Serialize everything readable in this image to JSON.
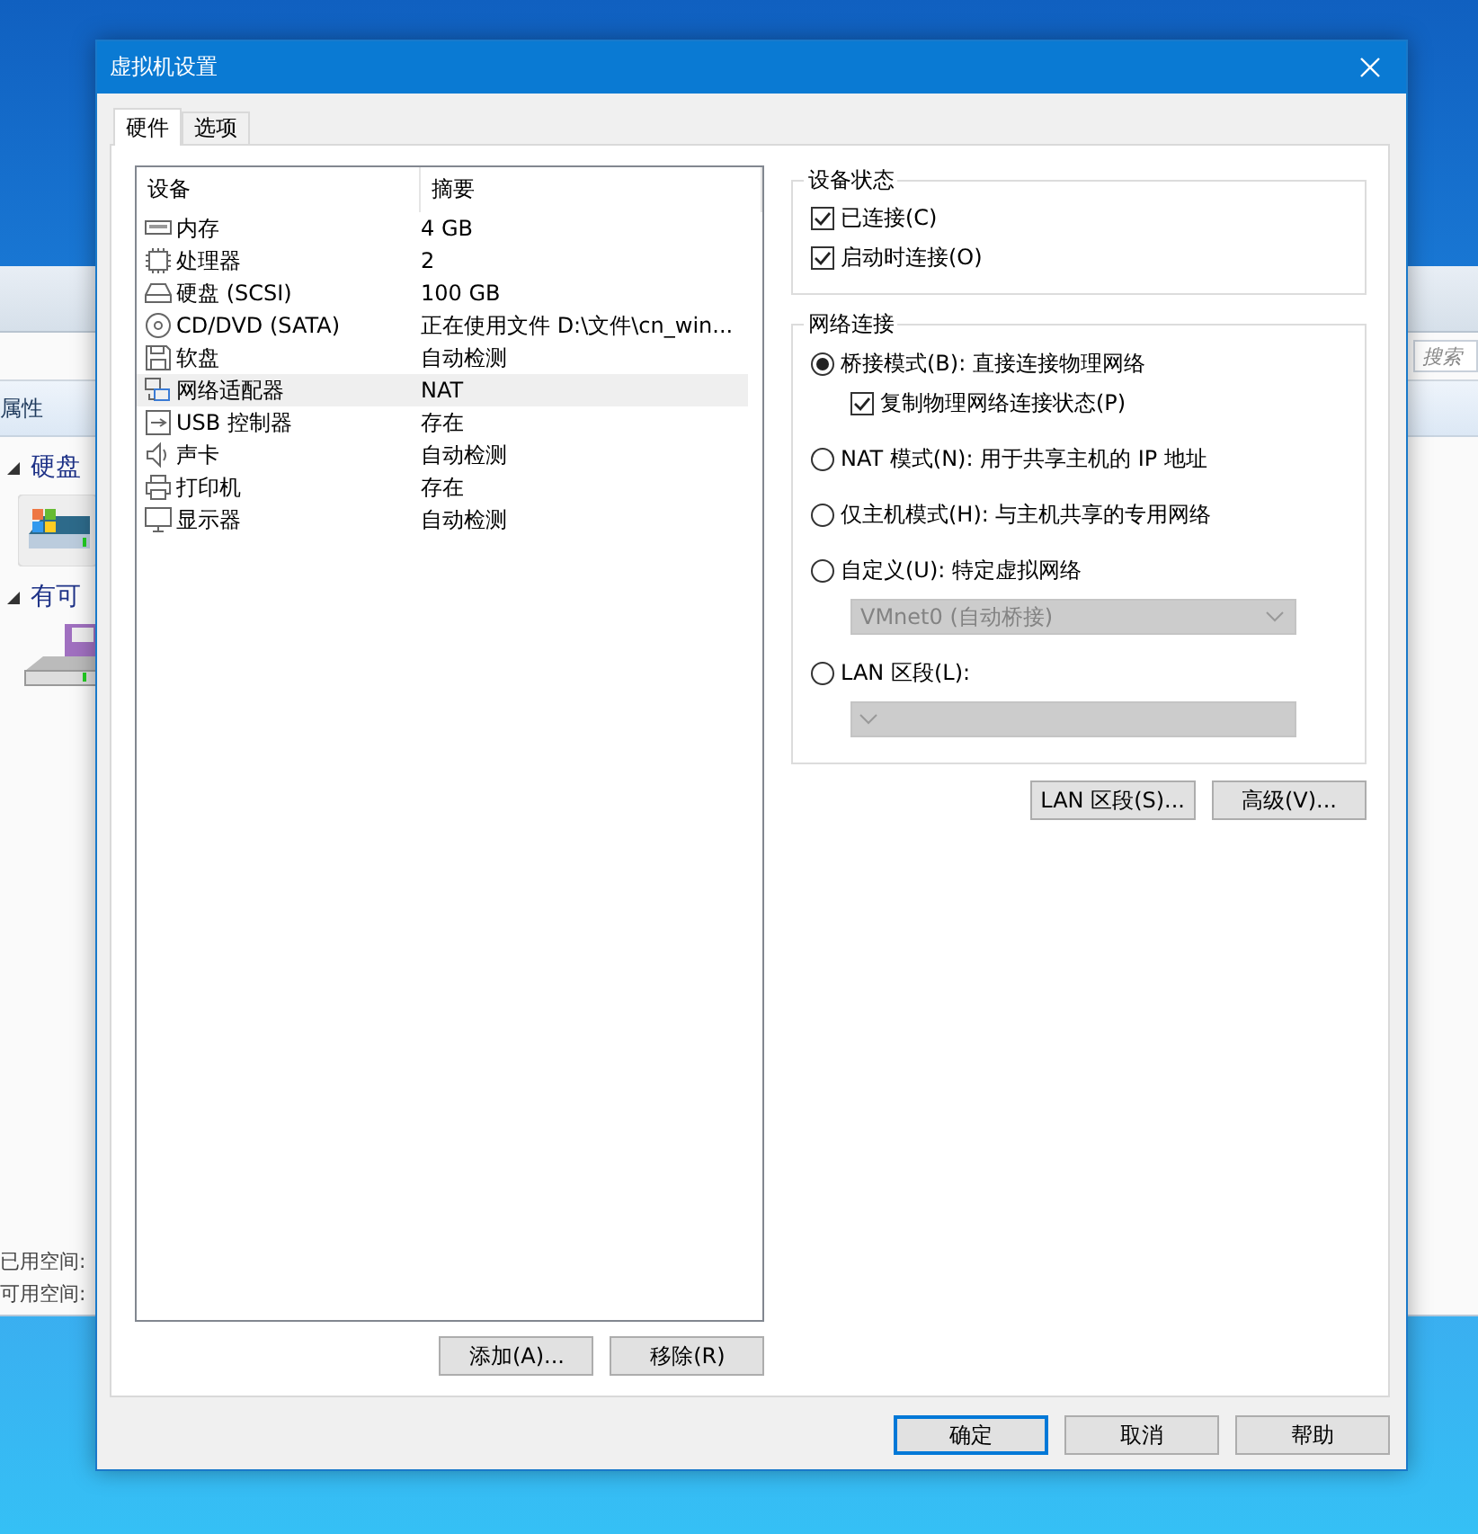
{
  "background_window": {
    "toolbar_label": "属性",
    "groups": [
      {
        "label": "硬盘",
        "kind": "hard-disk"
      },
      {
        "label": "有可",
        "kind": "removable"
      }
    ],
    "space_labels": [
      "已用空间:",
      "可用空间:"
    ],
    "search": {
      "placeholder": "搜索"
    }
  },
  "dialog": {
    "title": "虚拟机设置",
    "tabs": [
      {
        "label": "硬件",
        "selected": true
      },
      {
        "label": "选项",
        "selected": false
      }
    ],
    "device_table": {
      "columns": [
        "设备",
        "摘要"
      ],
      "rows": [
        {
          "kind": "memory",
          "device": "内存",
          "summary": "4 GB",
          "selected": false
        },
        {
          "kind": "cpu",
          "device": "处理器",
          "summary": "2",
          "selected": false
        },
        {
          "kind": "disk",
          "device": "硬盘 (SCSI)",
          "summary": "100 GB",
          "selected": false
        },
        {
          "kind": "cdrom",
          "device": "CD/DVD (SATA)",
          "summary": "正在使用文件 D:\\文件\\cn_win...",
          "selected": false
        },
        {
          "kind": "floppy",
          "device": "软盘",
          "summary": "自动检测",
          "selected": false
        },
        {
          "kind": "network",
          "device": "网络适配器",
          "summary": "NAT",
          "selected": true
        },
        {
          "kind": "usb",
          "device": "USB 控制器",
          "summary": "存在",
          "selected": false
        },
        {
          "kind": "sound",
          "device": "声卡",
          "summary": "自动检测",
          "selected": false
        },
        {
          "kind": "printer",
          "device": "打印机",
          "summary": "存在",
          "selected": false
        },
        {
          "kind": "display",
          "device": "显示器",
          "summary": "自动检测",
          "selected": false
        }
      ]
    },
    "device_buttons": [
      "添加(A)...",
      "移除(R)"
    ],
    "device_status": {
      "title": "设备状态",
      "options": [
        {
          "label": "已连接(C)",
          "checked": true
        },
        {
          "label": "启动时连接(O)",
          "checked": true
        }
      ]
    },
    "network": {
      "title": "网络连接",
      "options": [
        {
          "kind": "radio",
          "label": "桥接模式(B): 直接连接物理网络",
          "selected": true
        },
        {
          "kind": "checkbox",
          "label": "复制物理网络连接状态(P)",
          "checked": true
        },
        {
          "kind": "radio",
          "label": "NAT 模式(N): 用于共享主机的 IP 地址",
          "selected": false
        },
        {
          "kind": "radio",
          "label": "仅主机模式(H): 与主机共享的专用网络",
          "selected": false
        },
        {
          "kind": "radio",
          "label": "自定义(U): 特定虚拟网络",
          "selected": false
        },
        {
          "kind": "dropdown",
          "value": "VMnet0 (自动桥接)",
          "disabled": true
        },
        {
          "kind": "radio",
          "label": "LAN 区段(L):",
          "selected": false
        },
        {
          "kind": "dropdown",
          "disabled": true
        }
      ]
    },
    "network_buttons": [
      "LAN 区段(S)...",
      "高级(V)..."
    ],
    "footer_buttons": [
      {
        "label": "确定",
        "focused": true
      },
      {
        "label": "取消",
        "focused": false
      },
      {
        "label": "帮助",
        "focused": false
      }
    ]
  }
}
